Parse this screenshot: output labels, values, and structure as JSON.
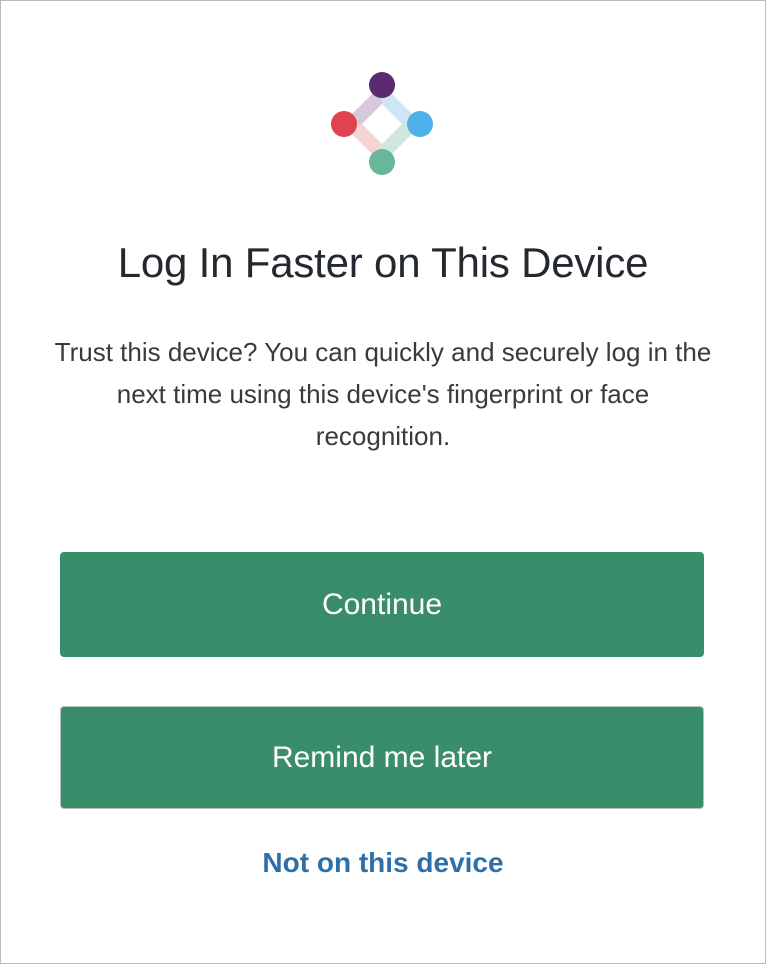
{
  "logo": {
    "icon": "trusted-device-logo-icon"
  },
  "title": "Log In Faster on This Device",
  "description": "Trust this device? You can quickly and securely log in the next time using this device's fingerprint or face recognition.",
  "actions": {
    "continue_label": "Continue",
    "remind_label": "Remind me later",
    "not_device_label": "Not on this device"
  },
  "colors": {
    "button_green": "#3a8d6a",
    "link_blue": "#2f6fa8",
    "dot_purple": "#5a2a72",
    "dot_red": "#e0424f",
    "dot_blue": "#4fb1ea",
    "dot_green": "#66b898"
  }
}
